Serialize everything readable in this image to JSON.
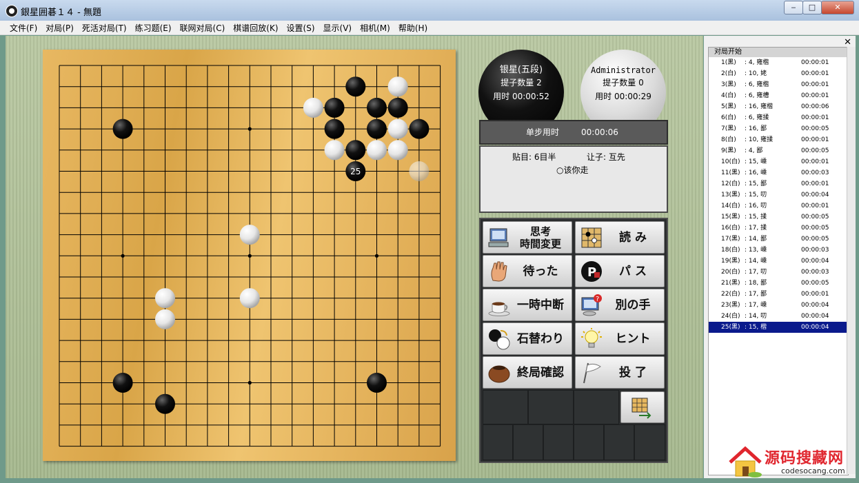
{
  "window": {
    "title": "銀星囲碁１４ - 無題",
    "min_label": "▭",
    "max_label": "□",
    "close_label": "✕"
  },
  "menu": [
    "文件(F)",
    "对局(P)",
    "死活对局(T)",
    "练习题(E)",
    "联网对局(C)",
    "棋谱回放(K)",
    "设置(S)",
    "显示(V)",
    "相机(M)",
    "帮助(H)"
  ],
  "board": {
    "size": 19,
    "hoshi": [
      [
        3,
        3
      ],
      [
        3,
        9
      ],
      [
        3,
        15
      ],
      [
        9,
        3
      ],
      [
        9,
        9
      ],
      [
        9,
        15
      ],
      [
        15,
        3
      ],
      [
        15,
        9
      ],
      [
        15,
        15
      ]
    ]
  },
  "stones": [
    {
      "c": "B",
      "x": 14,
      "y": 1
    },
    {
      "c": "W",
      "x": 16,
      "y": 1
    },
    {
      "c": "W",
      "x": 12,
      "y": 2
    },
    {
      "c": "B",
      "x": 13,
      "y": 2
    },
    {
      "c": "B",
      "x": 15,
      "y": 2
    },
    {
      "c": "B",
      "x": 16,
      "y": 2
    },
    {
      "c": "B",
      "x": 3,
      "y": 3
    },
    {
      "c": "B",
      "x": 13,
      "y": 3
    },
    {
      "c": "B",
      "x": 15,
      "y": 3
    },
    {
      "c": "W",
      "x": 16,
      "y": 3
    },
    {
      "c": "B",
      "x": 17,
      "y": 3
    },
    {
      "c": "W",
      "x": 13,
      "y": 4
    },
    {
      "c": "B",
      "x": 14,
      "y": 4
    },
    {
      "c": "W",
      "x": 15,
      "y": 4
    },
    {
      "c": "W",
      "x": 16,
      "y": 4
    },
    {
      "c": "B",
      "x": 14,
      "y": 5,
      "label": "25"
    },
    {
      "c": "G",
      "x": 17,
      "y": 5
    },
    {
      "c": "W",
      "x": 9,
      "y": 8
    },
    {
      "c": "W",
      "x": 5,
      "y": 11
    },
    {
      "c": "W",
      "x": 9,
      "y": 11
    },
    {
      "c": "W",
      "x": 5,
      "y": 12
    },
    {
      "c": "B",
      "x": 3,
      "y": 15
    },
    {
      "c": "B",
      "x": 15,
      "y": 15
    },
    {
      "c": "B",
      "x": 5,
      "y": 16
    }
  ],
  "black_player": {
    "name": "银星(五段)",
    "captures": "提子数量  2",
    "time": "用时  00:00:52"
  },
  "white_player": {
    "name": "Administrator",
    "captures": "提子数量  0",
    "time": "用时  00:00:29"
  },
  "step": {
    "label": "单步用时",
    "time": "00:00:06"
  },
  "info": {
    "komi": "贴目:  6目半",
    "handicap": "让子:  互先",
    "turn": "○该你走"
  },
  "buttons": [
    {
      "l1": "思考",
      "l2": "時間変更"
    },
    {
      "l1": "読 み",
      "l2": ""
    },
    {
      "l1": "待った",
      "l2": ""
    },
    {
      "l1": "パ ス",
      "l2": ""
    },
    {
      "l1": "一時中断",
      "l2": ""
    },
    {
      "l1": "別の手",
      "l2": ""
    },
    {
      "l1": "石替わり",
      "l2": ""
    },
    {
      "l1": "ヒント",
      "l2": ""
    },
    {
      "l1": "終局確認",
      "l2": ""
    },
    {
      "l1": "投 了",
      "l2": ""
    }
  ],
  "movelist": {
    "header": "对局开始",
    "rows": [
      {
        "n": "1(黑)",
        "p": ":  4,  雍楷",
        "t": "00:00:01"
      },
      {
        "n": "2(白)",
        "p": ": 10,   姥",
        "t": "00:00:01"
      },
      {
        "n": "3(黑)",
        "p": ":  6,  雍楷",
        "t": "00:00:01"
      },
      {
        "n": "4(白)",
        "p": ":  6,  雍槽",
        "t": "00:00:01"
      },
      {
        "n": "5(黑)",
        "p": ": 16,  雍楷",
        "t": "00:00:06"
      },
      {
        "n": "6(白)",
        "p": ":  6,  雍揉",
        "t": "00:00:01"
      },
      {
        "n": "7(黑)",
        "p": ": 16,   鄙",
        "t": "00:00:05"
      },
      {
        "n": "8(白)",
        "p": ": 10,  雍揉",
        "t": "00:00:01"
      },
      {
        "n": "9(黑)",
        "p": ":  4,   鄙",
        "t": "00:00:05"
      },
      {
        "n": "10(白)",
        "p": ": 15,   嵊",
        "t": "00:00:01"
      },
      {
        "n": "11(黑)",
        "p": ": 16,   嵊",
        "t": "00:00:03"
      },
      {
        "n": "12(白)",
        "p": ": 15,   鄙",
        "t": "00:00:01"
      },
      {
        "n": "13(黑)",
        "p": ": 15,   叨",
        "t": "00:00:04"
      },
      {
        "n": "14(白)",
        "p": ": 16,   叨",
        "t": "00:00:01"
      },
      {
        "n": "15(黑)",
        "p": ": 15,   揉",
        "t": "00:00:05"
      },
      {
        "n": "16(白)",
        "p": ": 17,   揉",
        "t": "00:00:05"
      },
      {
        "n": "17(黑)",
        "p": ": 14,   鄙",
        "t": "00:00:05"
      },
      {
        "n": "18(白)",
        "p": ": 13,   嵊",
        "t": "00:00:03"
      },
      {
        "n": "19(黑)",
        "p": ": 14,   嵊",
        "t": "00:00:04"
      },
      {
        "n": "20(白)",
        "p": ": 17,   叨",
        "t": "00:00:03"
      },
      {
        "n": "21(黑)",
        "p": ": 18,   鄙",
        "t": "00:00:05"
      },
      {
        "n": "22(白)",
        "p": ": 17,   鄙",
        "t": "00:00:01"
      },
      {
        "n": "23(黑)",
        "p": ": 17,   嵊",
        "t": "00:00:04"
      },
      {
        "n": "24(白)",
        "p": ": 14,   叨",
        "t": "00:00:04"
      },
      {
        "n": "25(黑)",
        "p": ": 15,   楷",
        "t": "00:00:04"
      }
    ]
  },
  "watermark": {
    "brand": "源码搜藏网",
    "url": "codesocang.com"
  }
}
